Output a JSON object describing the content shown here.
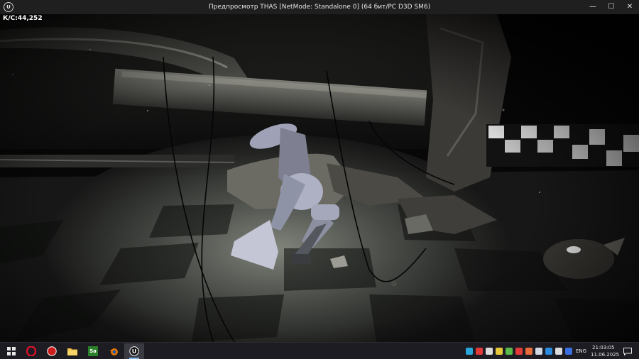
{
  "window": {
    "title": "Предпросмотр THAS [NetMode: Standalone 0]  (64 бит/PC D3D SM6)",
    "app_logo_text": "U",
    "controls": {
      "minimize": "—",
      "maximize": "☐",
      "close": "✕"
    }
  },
  "viewport": {
    "fps_text": "К/С:44,252"
  },
  "taskbar": {
    "apps": [
      {
        "name": "opera",
        "icon": "opera-icon",
        "color": "#d9112a"
      },
      {
        "name": "red-app",
        "icon": "red-circle-icon",
        "color": "#cc1d1d"
      },
      {
        "name": "file-explorer",
        "icon": "folder-icon",
        "color": "#f1c24a"
      },
      {
        "name": "sa-app",
        "label": "Sa",
        "icon": "sa-icon",
        "color": "#2a7f2a"
      },
      {
        "name": "blender",
        "icon": "blender-icon",
        "color": "#ea7600"
      },
      {
        "name": "unreal-engine",
        "icon": "unreal-engine-icon",
        "color": "#ffffff",
        "active": true
      }
    ],
    "tray": {
      "language": "ENG",
      "time": "21:03:05",
      "date": "11.06.2025"
    }
  }
}
